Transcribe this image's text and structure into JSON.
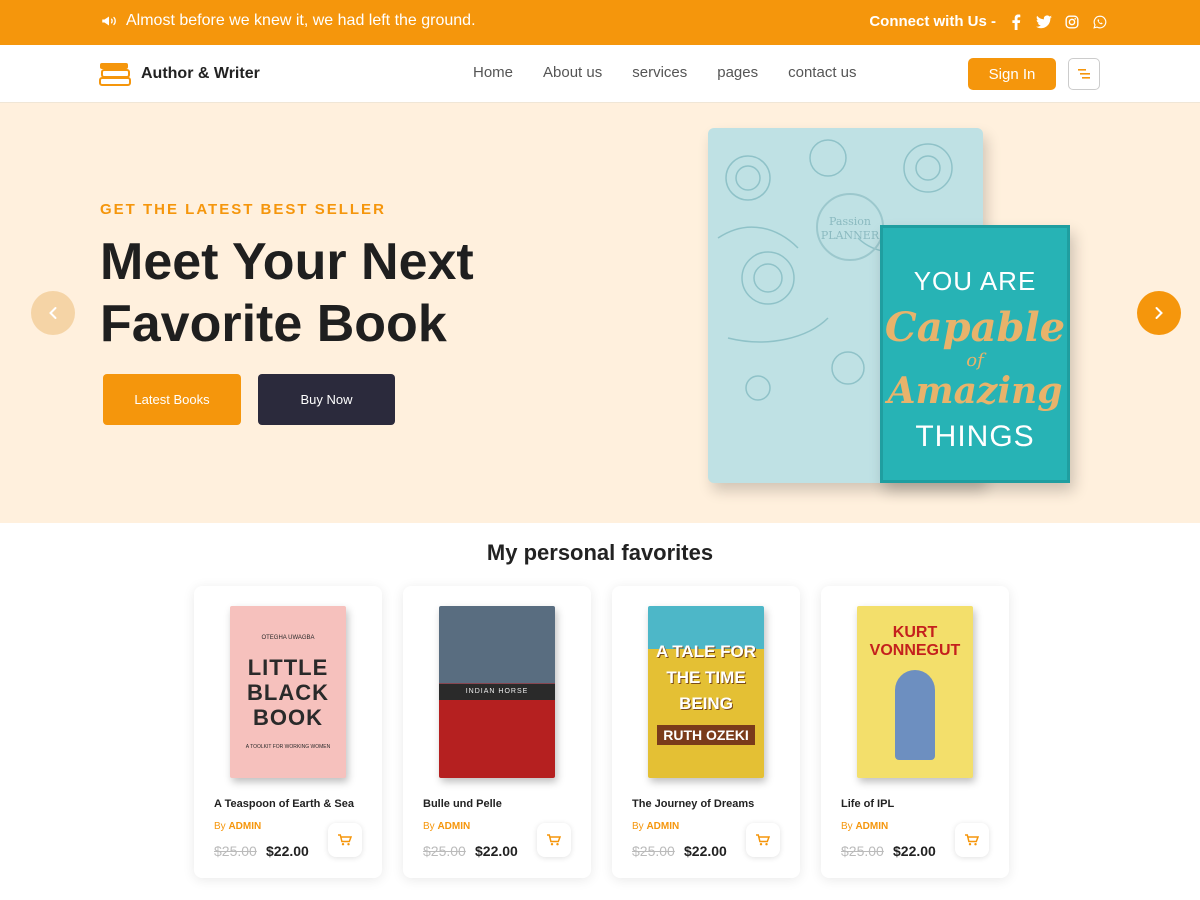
{
  "topbar": {
    "announcement": "Almost before we knew it, we had left the ground.",
    "connect_label": "Connect with Us -",
    "social_icons": [
      "facebook-icon",
      "twitter-icon",
      "instagram-icon",
      "whatsapp-icon"
    ]
  },
  "brand": {
    "name": "Author & Writer",
    "accent_color": "#f5960c",
    "dark_color": "#2b2a3c",
    "hero_bg": "#fff0dd"
  },
  "nav": {
    "links": [
      "Home",
      "About us",
      "services",
      "pages",
      "contact us"
    ],
    "signin_label": "Sign In"
  },
  "hero": {
    "eyebrow": "GET THE LATEST BEST SELLER",
    "title": "Meet Your Next Favorite Book",
    "btn_primary": "Latest Books",
    "btn_secondary": "Buy Now",
    "planner_text": "Passion PLANNER",
    "notebook": {
      "line1": "YOU ARE",
      "line2": "Capable",
      "line3": "of",
      "line4": "Amazing",
      "line5": "THINGS"
    }
  },
  "favorites": {
    "section_title": "My personal favorites",
    "by_label": "By",
    "items": [
      {
        "title": "A Teaspoon of Earth & Sea",
        "author": "ADMIN",
        "old_price": "$25.00",
        "price": "$22.00",
        "cover": {
          "top": "OTEGHA UWAGBA",
          "main": "LITTLE BLACK BOOK",
          "foot": "A TOOLKIT FOR WORKING WOMEN"
        }
      },
      {
        "title": "Bulle und Pelle",
        "author": "ADMIN",
        "old_price": "$25.00",
        "price": "$22.00",
        "cover": {
          "main": "INDIAN HORSE"
        }
      },
      {
        "title": "The Journey of Dreams",
        "author": "ADMIN",
        "old_price": "$25.00",
        "price": "$22.00",
        "cover": {
          "main": "A TALE FOR THE TIME BEING",
          "foot": "RUTH OZEKI"
        }
      },
      {
        "title": "Life of IPL",
        "author": "ADMIN",
        "old_price": "$25.00",
        "price": "$22.00",
        "cover": {
          "main": "KURT VONNEGUT"
        }
      }
    ]
  }
}
